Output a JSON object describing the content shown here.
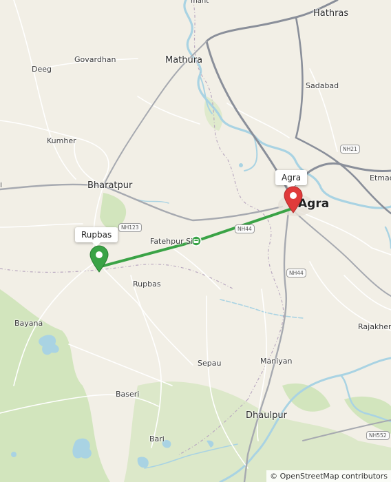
{
  "places": {
    "hathras": "Hathras",
    "govardhan": "Govardhan",
    "mathura": "Mathura",
    "deeg": "Deeg",
    "sadabad": "Sadabad",
    "kumher": "Kumher",
    "etmad": "Etmad",
    "bharatpur": "Bharatpur",
    "agra": "Agra",
    "fatehpur_sikri": "Fatehpur Si",
    "rupbas": "Rupbas",
    "bayana": "Bayana",
    "rajakhera": "Rajakhera",
    "sepau": "Sepau",
    "maniyan": "Maniyan",
    "baseri": "Baseri",
    "dhaulpur": "Dhaulpur",
    "bari": "Bari",
    "top_fragment": "mant",
    "left_fragment": "i"
  },
  "shields": {
    "nh21": "NH21",
    "nh123": "NH123",
    "nh44_a": "NH44",
    "nh44_b": "NH44",
    "nh552": "NH552"
  },
  "route": {
    "origin_label": "Rupbas",
    "destination_label": "Agra",
    "origin_color": "#3aa346",
    "destination_color": "#e03a3a",
    "line_color": "#3aa346",
    "toll_icon": "toll-icon"
  },
  "attribution": {
    "symbol": "©",
    "text": "OpenStreetMap contributors"
  }
}
